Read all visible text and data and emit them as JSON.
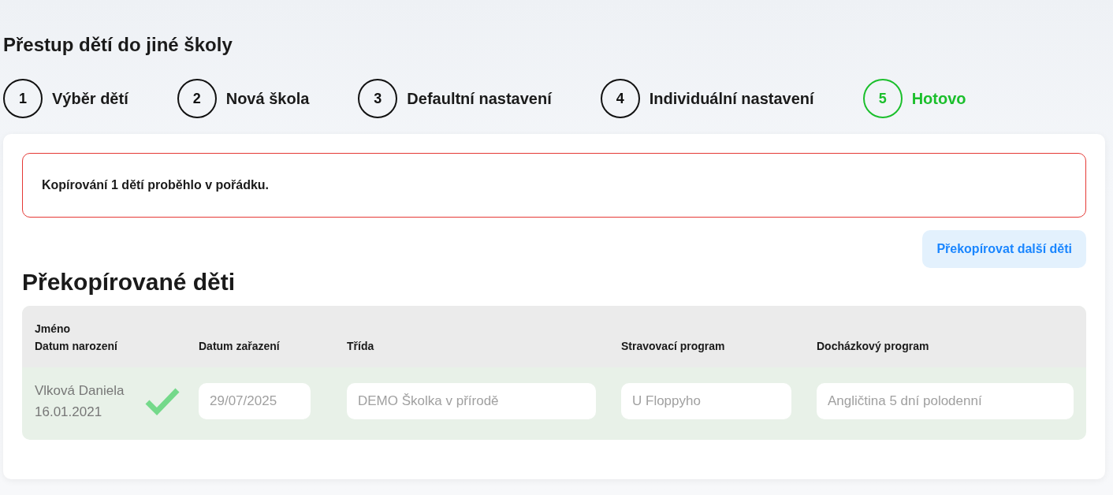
{
  "page_title": "Přestup dětí do jiné školy",
  "steps": [
    {
      "number": "1",
      "label": "Výběr dětí",
      "selected": false
    },
    {
      "number": "2",
      "label": "Nová škola",
      "selected": false
    },
    {
      "number": "3",
      "label": "Defaultní nastavení",
      "selected": false
    },
    {
      "number": "4",
      "label": "Individuální nastavení",
      "selected": false
    },
    {
      "number": "5",
      "label": "Hotovo",
      "selected": true
    }
  ],
  "alert": {
    "text": "Kopírování 1 dětí proběhlo v pořádku."
  },
  "copy_more_button": "Překopírovat další děti",
  "section_title": "Překopírované děti",
  "table": {
    "columns": [
      {
        "lines": [
          "Jméno",
          "Datum narození"
        ]
      },
      {
        "lines": [
          "Datum zařazení"
        ]
      },
      {
        "lines": [
          "Třída"
        ]
      },
      {
        "lines": [
          "Stravovací program"
        ]
      },
      {
        "lines": [
          "Docházkový program"
        ]
      }
    ],
    "rows": [
      {
        "name": "Vlková Daniela",
        "birth_date": "16.01.2021",
        "copied": true,
        "fields": [
          {
            "value": "29/07/2025",
            "disabled": true
          },
          {
            "value": "DEMO Školka v přírodě",
            "disabled": true
          },
          {
            "value": "U Floppyho",
            "disabled": true
          },
          {
            "value": "Angličtina 5 dní polodenní",
            "disabled": true
          }
        ]
      }
    ]
  }
}
